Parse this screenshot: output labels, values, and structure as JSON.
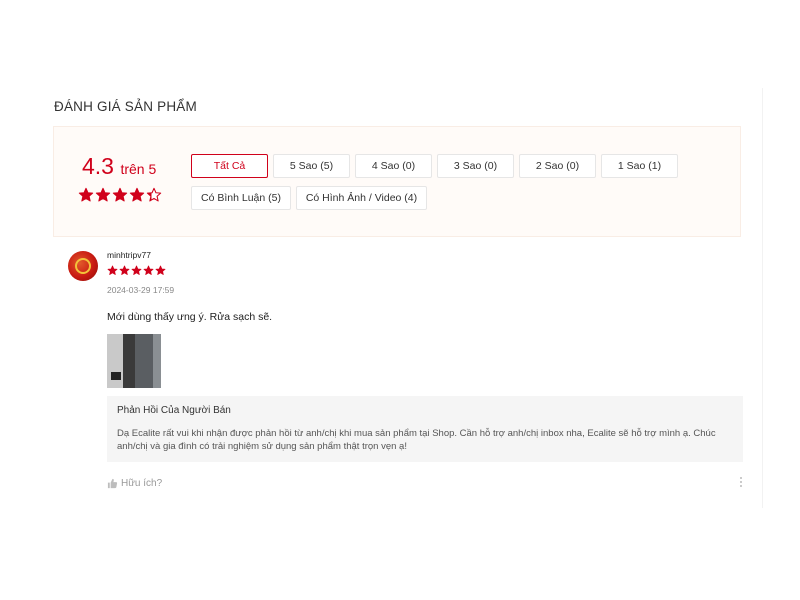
{
  "section": {
    "title": "ĐÁNH GIÁ SẢN PHẨM"
  },
  "summary": {
    "score": "4.3",
    "score_suffix": "trên 5",
    "rating_value": 4.3,
    "rating_max": 5,
    "filters": [
      {
        "label": "Tất Cả",
        "active": true
      },
      {
        "label": "5 Sao (5)"
      },
      {
        "label": "4 Sao (0)"
      },
      {
        "label": "3 Sao (0)"
      },
      {
        "label": "2 Sao (0)"
      },
      {
        "label": "1 Sao (1)"
      },
      {
        "label": "Có Bình Luận (5)"
      },
      {
        "label": "Có Hình Ảnh / Video (4)"
      }
    ]
  },
  "review": {
    "username": "minhtripv77",
    "rating": 5,
    "timestamp": "2024-03-29 17:59",
    "comment": "Mới dùng thấy ưng ý. Rửa sạch sẽ.",
    "seller_reply": {
      "title": "Phản Hồi Của Người Bán",
      "text": "Dạ Ecalite rất vui khi nhận được phản hồi từ anh/chị khi mua sản phẩm tại Shop. Cần hỗ trợ anh/chị inbox nha, Ecalite sẽ hỗ trợ mình ạ. Chúc anh/chị và gia đình có trải nghiệm sử dụng sản phẩm thật trọn vẹn ạ!"
    },
    "helpful_label": "Hữu ích?"
  },
  "icons": {
    "star": "star-icon",
    "thumbs_up": "thumbs-up-icon",
    "more": "more-vertical-icon"
  },
  "colors": {
    "accent": "#d0011b",
    "summary_bg": "#fffbf8",
    "seller_reply_bg": "#f5f5f5"
  }
}
